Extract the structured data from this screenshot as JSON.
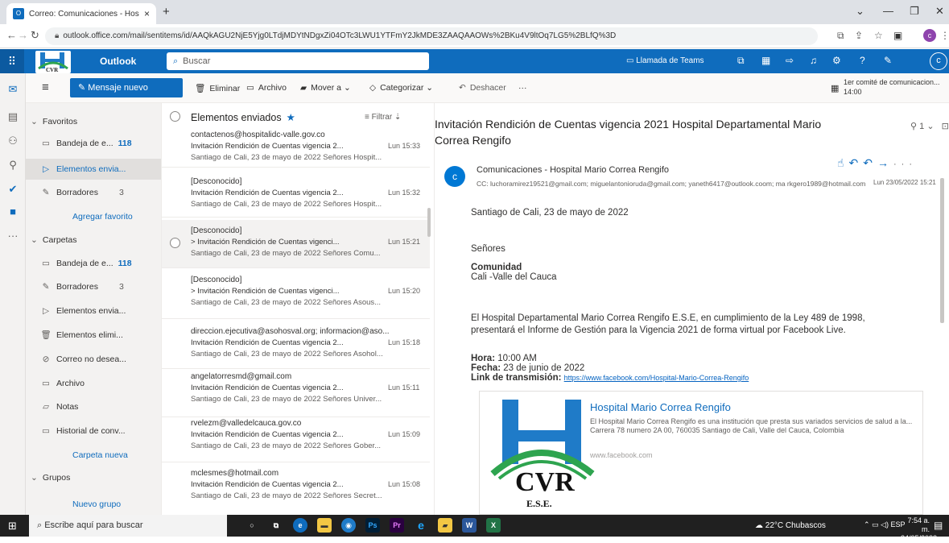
{
  "browser": {
    "tab_title": "Correo: Comunicaciones - Hosp",
    "tab_close": "×",
    "new_tab": "+",
    "url": "outlook.office.com/mail/sentitems/id/AAQkAGU2NjE5Yjg0LTdjMDYtNDgxZi04OTc3LWU1YTFmY2JkMDE3ZAAQAAOWs%2BKu4V9ltOq7LG5%2BLfQ%3D",
    "profile_initial": "c"
  },
  "outlook": {
    "brand": "Outlook",
    "search_placeholder": "Buscar",
    "teams_call": "Llamada de Teams",
    "me_initial": "c"
  },
  "commands": {
    "new_message": "Mensaje nuevo",
    "delete": "Eliminar",
    "archive": "Archivo",
    "move_to": "Mover a",
    "categorize": "Categorizar",
    "undo": "Deshacer",
    "more": "···",
    "meeting_title": "1er comité de comunicacion...",
    "meeting_time": "14:00"
  },
  "folders": {
    "favorites_header": "Favoritos",
    "favorites": [
      {
        "label": "Bandeja de e...",
        "count": "118"
      },
      {
        "label": "Elementos envia...",
        "count": ""
      },
      {
        "label": "Borradores",
        "count": "3"
      }
    ],
    "add_favorite": "Agregar favorito",
    "folders_header": "Carpetas",
    "folders": [
      {
        "label": "Bandeja de e...",
        "count": "118"
      },
      {
        "label": "Borradores",
        "count": "3"
      },
      {
        "label": "Elementos envia...",
        "count": ""
      },
      {
        "label": "Elementos elimi...",
        "count": ""
      },
      {
        "label": "Correo no desea...",
        "count": ""
      },
      {
        "label": "Archivo",
        "count": ""
      },
      {
        "label": "Notas",
        "count": ""
      },
      {
        "label": "Historial de conv...",
        "count": ""
      }
    ],
    "new_folder": "Carpeta nueva",
    "groups_header": "Grupos",
    "new_group": "Nuevo grupo"
  },
  "message_list": {
    "title": "Elementos enviados",
    "filter": "Filtrar",
    "items": [
      {
        "sender": "contactenos@hospitalidc-valle.gov.co",
        "subject": "Invitación Rendición de Cuentas vigencia 2...",
        "time": "Lun 15:33",
        "preview": "Santiago de Cali, 23 de mayo de 2022 Señores Hospit..."
      },
      {
        "sender": "[Desconocido]",
        "subject": "Invitación Rendición de Cuentas vigencia 2...",
        "time": "Lun 15:32",
        "preview": "Santiago de Cali, 23 de mayo de 2022 Señores Hospit..."
      },
      {
        "sender": "[Desconocido]",
        "subject": "> Invitación Rendición de Cuentas vigenci...",
        "time": "Lun 15:21",
        "preview": "Santiago de Cali, 23 de mayo de 2022 Señores Comu..."
      },
      {
        "sender": "[Desconocido]",
        "subject": "> Invitación Rendición de Cuentas vigenci...",
        "time": "Lun 15:20",
        "preview": "Santiago de Cali, 23 de mayo de 2022 Señores Asous..."
      },
      {
        "sender": "direccion.ejecutiva@asohosval.org; informacion@aso...",
        "subject": "Invitación Rendición de Cuentas vigencia 2...",
        "time": "Lun 15:18",
        "preview": "Santiago de Cali, 23 de mayo de 2022 Señores Asohol..."
      },
      {
        "sender": "angelatorresmd@gmail.com",
        "subject": "Invitación Rendición de Cuentas vigencia 2...",
        "time": "Lun 15:11",
        "preview": "Santiago de Cali, 23 de mayo de 2022 Señores Univer..."
      },
      {
        "sender": "rvelezm@valledelcauca.gov.co",
        "subject": "Invitación Rendición de Cuentas vigencia 2...",
        "time": "Lun 15:09",
        "preview": "Santiago de Cali, 23 de mayo de 2022 Señores Gober..."
      },
      {
        "sender": "mclesmes@hotmail.com",
        "subject": "Invitación Rendición de Cuentas vigencia 2...",
        "time": "Lun 15:08",
        "preview": "Santiago de Cali, 23 de mayo de 2022 Señores Secret..."
      }
    ]
  },
  "reading": {
    "subject": "Invitación Rendición de Cuentas vigencia 2021 Hospital Departamental Mario Correa Rengifo",
    "actions_count": "1",
    "avatar_initial": "c",
    "from": "Comunicaciones - Hospital Mario Correa Rengifo",
    "cc": "CC: luchoramirez19521@gmail.com; miguelantonioruda@gmail.com; yaneth6417@outlook.coom; ma rkgero1989@hotmail.com",
    "date": "Lun 23/05/2022 15:21",
    "body": {
      "place_date": "Santiago de Cali, 23 de mayo de 2022",
      "greeting": "Señores",
      "recipient_bold": "Comunidad",
      "recipient_city": "Cali -Valle del Cauca",
      "para1": "El Hospital Departamental Mario Correa Rengifo E.S.E, en cumplimiento de la Ley 489 de 1998,",
      "para2": "presentará el Informe de Gestión para la Vigencia 2021 de forma virtual por Facebook Live.",
      "hora_label": "Hora:",
      "hora_value": " 10:00 AM",
      "fecha_label": "Fecha:",
      "fecha_value": " 23 de junio de 2022",
      "link_label": "Link de transmisión:",
      "link_value": "https://www.facebook.com/Hospital-Mario-Correa-Rengifo"
    },
    "card": {
      "title": "Hospital Mario Correa Rengifo",
      "description": "El Hospital Mario Correa Rengifo es una institución que presta sus variados servicios de salud a la... Carrera 78 numero 2A 00, 760035 Santiago de Cali, Valle del Cauca, Colombia",
      "url": "www.facebook.com",
      "logo_text": "CVR",
      "logo_sub": "E.S.E."
    }
  },
  "taskbar": {
    "search_placeholder": "Escribe aquí para buscar",
    "weather": "22°C Chubascos",
    "lang": "ESP",
    "time": "7:54 a. m.",
    "date": "24/05/2022"
  },
  "colors": {
    "accent": "#0f6cbd",
    "taskbar": "#202020"
  }
}
